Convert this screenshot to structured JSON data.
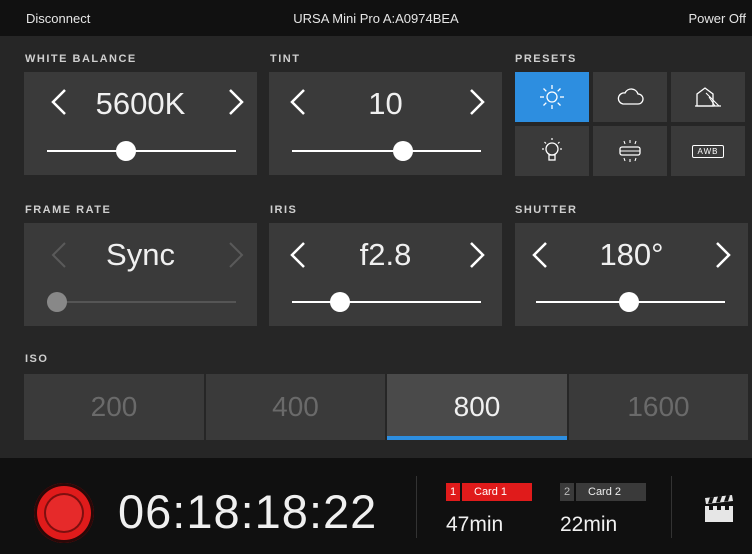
{
  "topbar": {
    "left": "Disconnect",
    "title": "URSA Mini Pro A:A0974BEA",
    "right": "Power Off"
  },
  "white_balance": {
    "label": "WHITE BALANCE",
    "value": "5600K",
    "slider": 0.41
  },
  "tint": {
    "label": "TINT",
    "value": "10",
    "slider": 0.58
  },
  "presets": {
    "label": "PRESETS",
    "items": [
      "sun-icon",
      "cloud-icon",
      "shade-icon",
      "bulb-icon",
      "fluorescent-icon",
      "awb-icon"
    ],
    "awb_text": "AWB",
    "active": 0
  },
  "frame_rate": {
    "label": "FRAME RATE",
    "value": "Sync",
    "slider": 0.0
  },
  "iris": {
    "label": "IRIS",
    "value": "f2.8",
    "slider": 0.25
  },
  "shutter": {
    "label": "SHUTTER",
    "value": "180°",
    "slider": 0.5
  },
  "iso": {
    "label": "ISO",
    "options": [
      "200",
      "400",
      "800",
      "1600"
    ],
    "active": "800"
  },
  "recorder": {
    "timecode": "06:18:18:22",
    "card1": {
      "num": "1",
      "name": "Card 1",
      "time": "47min",
      "color": "#e01b1b"
    },
    "card2": {
      "num": "2",
      "name": "Card 2",
      "time": "22min",
      "color": "#3a3a3a"
    }
  },
  "colors": {
    "accent": "#2d8ee0",
    "record": "#e01b1b"
  }
}
